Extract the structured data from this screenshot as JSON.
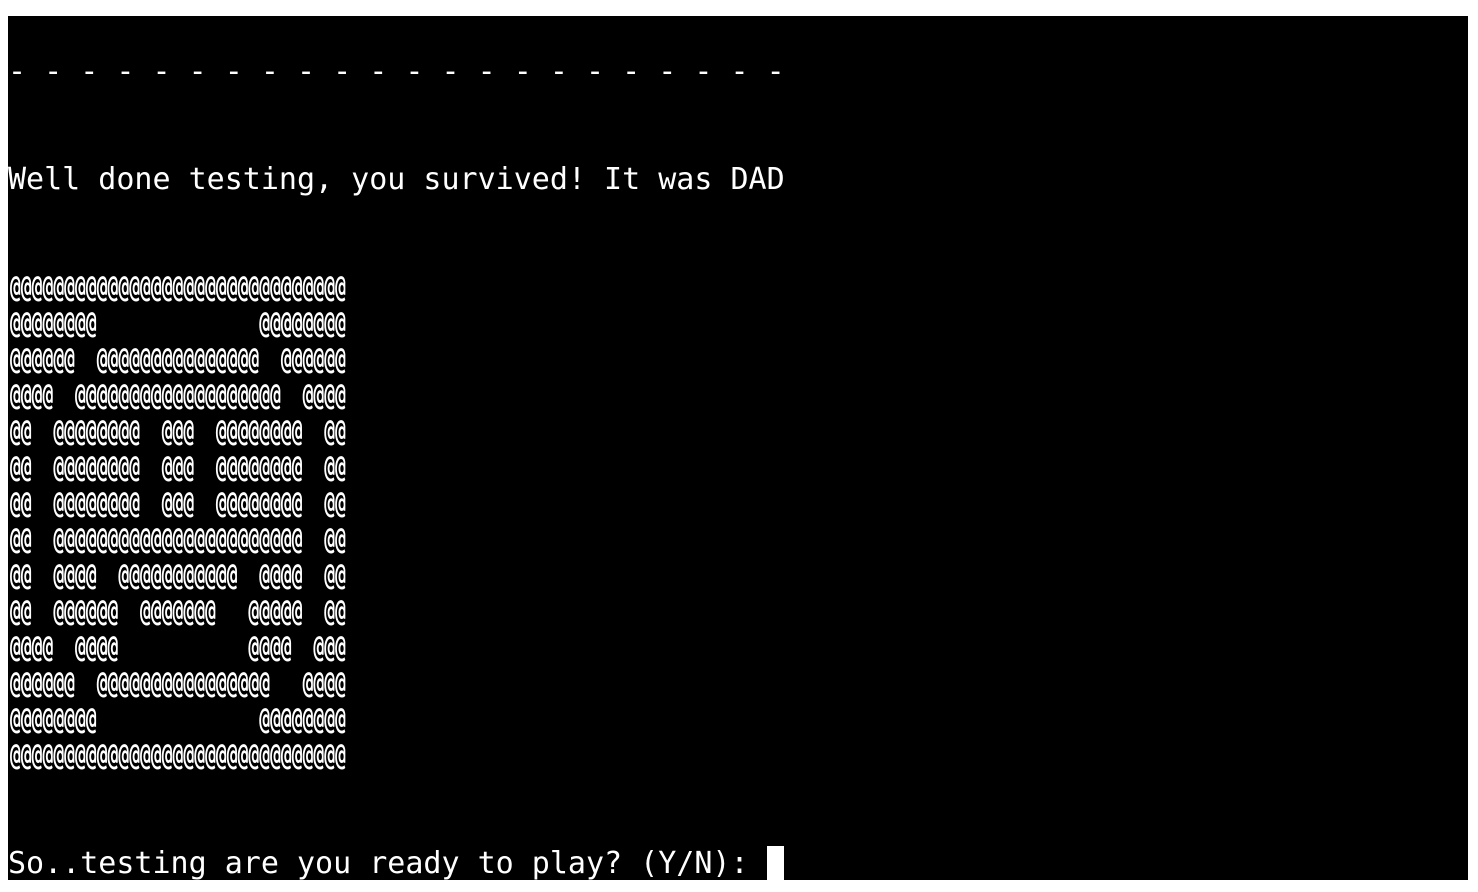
{
  "terminal": {
    "separator": "- - - - - - - - - - - - - - - - - - - - - -",
    "message": "Well done testing, you survived! It was DAD",
    "ascii_art": [
      "@@@@@@@@@@@@@@@@@@@@@@@@@@@@@@@",
      "@@@@@@@@               @@@@@@@@",
      "@@@@@@  @@@@@@@@@@@@@@@  @@@@@@",
      "@@@@  @@@@@@@@@@@@@@@@@@@  @@@@",
      "@@  @@@@@@@@  @@@  @@@@@@@@  @@",
      "@@  @@@@@@@@  @@@  @@@@@@@@  @@",
      "@@  @@@@@@@@  @@@  @@@@@@@@  @@",
      "@@  @@@@@@@@@@@@@@@@@@@@@@@  @@",
      "@@  @@@@  @@@@@@@@@@@  @@@@  @@",
      "@@  @@@@@@  @@@@@@@   @@@@@  @@",
      "@@@@  @@@@            @@@@  @@@",
      "@@@@@@  @@@@@@@@@@@@@@@@   @@@@",
      "@@@@@@@@               @@@@@@@@",
      "@@@@@@@@@@@@@@@@@@@@@@@@@@@@@@@"
    ],
    "prompt": "So..testing are you ready to play? (Y/N): "
  }
}
